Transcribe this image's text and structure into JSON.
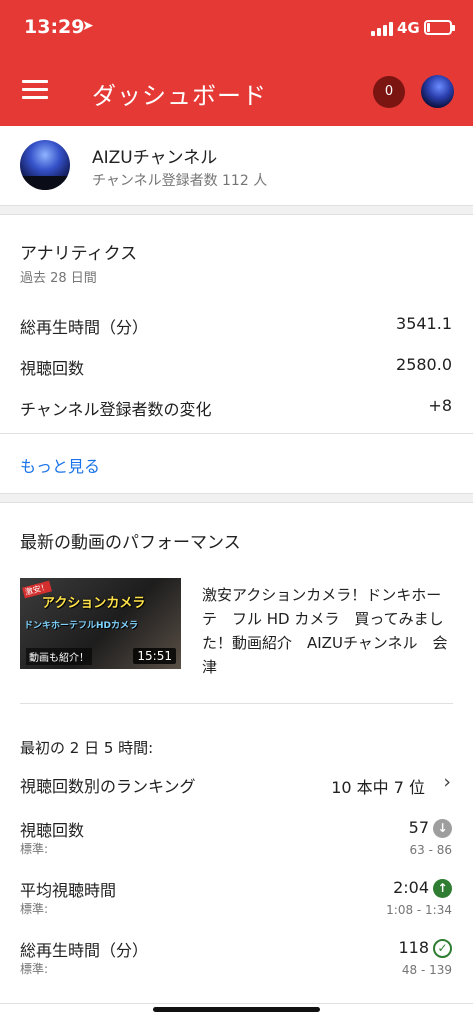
{
  "status_bar": {
    "time": "13:29",
    "location_arrow": "➤",
    "network": "4G",
    "battery_level": 0.15,
    "accent_color": "#e53935"
  },
  "app_bar": {
    "title": "ダッシュボード",
    "notification_count": "0",
    "menu_icon": "hamburger-menu-icon",
    "avatar": "channel-avatar"
  },
  "channel": {
    "name": "AIZUチャンネル",
    "subscribers": "チャンネル登録者数 112 人"
  },
  "analytics": {
    "title": "アナリティクス",
    "period": "過去 28 日間",
    "metrics": [
      {
        "label": "総再生時間（分）",
        "value": "3541.1"
      },
      {
        "label": "視聴回数",
        "value": "2580.0"
      },
      {
        "label": "チャンネル登録者数の変化",
        "value": "+8"
      }
    ],
    "more_link": "もっと見る",
    "link_color": "#1a73e8"
  },
  "latest_video": {
    "section_title": "最新の動画のパフォーマンス",
    "thumbnail": {
      "badge": "激安！",
      "title_text": "アクションカメラ",
      "subtitle_text": "ドンキホーテフルHDカメラ",
      "note_text": "動画も紹介！",
      "duration": "15:51"
    },
    "video_title": "激安アクションカメラ！ドンキホーテ　フル HD カメラ　買ってみました！動画紹介　AIZUチャンネル　会津",
    "period": "最初の 2 日 5 時間:",
    "ranking": {
      "label": "視聴回数別のランキング",
      "value": "10 本中 7 位"
    },
    "stats": [
      {
        "label": "視聴回数",
        "norm_label": "標準:",
        "value": "57",
        "range": "63 - 86",
        "icon": "arrow-down-icon",
        "icon_glyph": "↓"
      },
      {
        "label": "平均視聴時間",
        "norm_label": "標準:",
        "value": "2:04",
        "range": "1:08 - 1:34",
        "icon": "arrow-up-icon",
        "icon_glyph": "↑"
      },
      {
        "label": "総再生時間（分）",
        "norm_label": "標準:",
        "value": "118",
        "range": "48 - 139",
        "icon": "check-circle-icon",
        "icon_glyph": "✓"
      }
    ]
  }
}
